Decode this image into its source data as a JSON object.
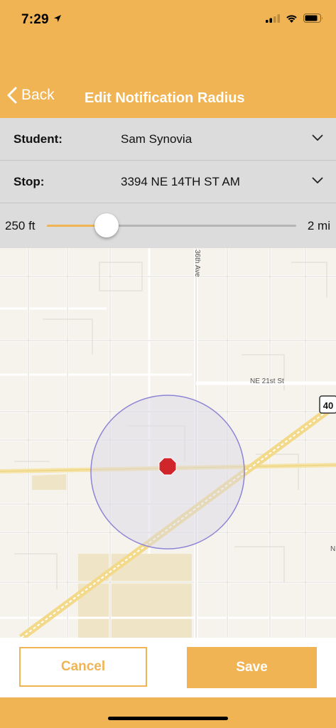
{
  "status_bar": {
    "time": "7:29"
  },
  "nav": {
    "back_label": "Back",
    "title": "Edit Notification Radius"
  },
  "form": {
    "student_label": "Student:",
    "student_value": "Sam Synovia",
    "stop_label": "Stop:",
    "stop_value": "3394 NE 14TH ST AM"
  },
  "slider": {
    "min_label": "250 ft",
    "max_label": "2 mi",
    "value_fraction": 0.24
  },
  "map": {
    "labels": {
      "avenue": "36th Ave",
      "street": "NE 21st St",
      "edge_letter": "N",
      "route_shield": "40"
    },
    "colors": {
      "radius_fill": "#d9d9e6",
      "radius_stroke": "#8c84d6",
      "stop_marker": "#d0252b"
    }
  },
  "actions": {
    "cancel_label": "Cancel",
    "save_label": "Save"
  },
  "colors": {
    "accent": "#f0b454"
  }
}
